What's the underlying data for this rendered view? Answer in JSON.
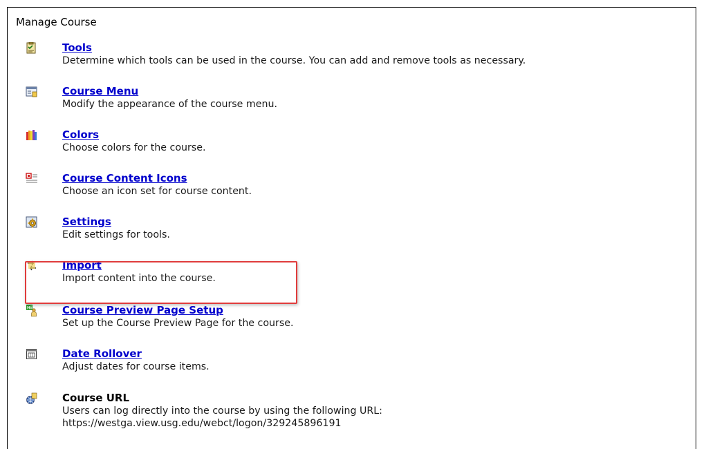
{
  "panel": {
    "title": "Manage Course"
  },
  "items": [
    {
      "icon": "tools-icon",
      "title": "Tools",
      "description": "Determine which tools can be used in the course. You can add and remove tools as necessary.",
      "link": true
    },
    {
      "icon": "course-menu-icon",
      "title": "Course Menu",
      "description": "Modify the appearance of the course menu.",
      "link": true
    },
    {
      "icon": "colors-icon",
      "title": "Colors",
      "description": "Choose colors for the course.",
      "link": true
    },
    {
      "icon": "course-content-icons-icon",
      "title": "Course Content Icons",
      "description": "Choose an icon set for course content.",
      "link": true
    },
    {
      "icon": "settings-icon",
      "title": "Settings",
      "description": "Edit settings for tools.",
      "link": true
    },
    {
      "icon": "import-icon",
      "title": "Import",
      "description": "Import content into the course.",
      "link": true,
      "highlighted": true
    },
    {
      "icon": "course-preview-icon",
      "title": "Course Preview Page Setup",
      "description": "Set up the Course Preview Page for the course.",
      "link": true
    },
    {
      "icon": "calendar-icon",
      "title": "Date Rollover",
      "description": "Adjust dates for course items.",
      "link": true
    },
    {
      "icon": "globe-icon",
      "title": "Course URL",
      "description": "Users can log directly into the course by using the following URL:",
      "description_line2": "https://westga.view.usg.edu/webct/logon/329245896191",
      "link": false
    }
  ],
  "colors": {
    "link": "#0000cc",
    "highlight_border": "#e03c3c"
  }
}
